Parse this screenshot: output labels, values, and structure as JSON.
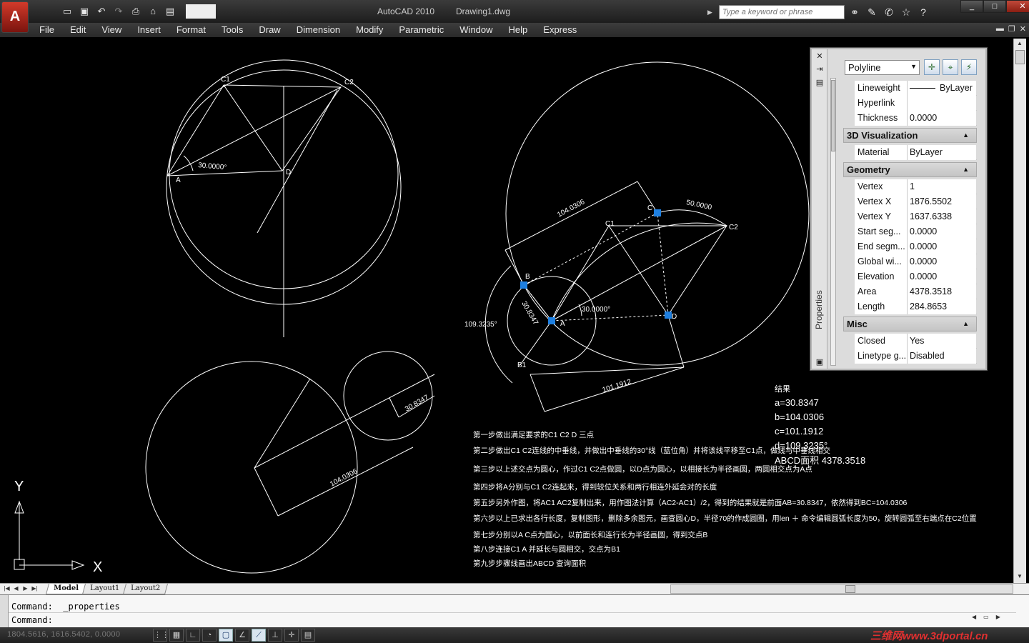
{
  "titlebar": {
    "app_name": "AutoCAD 2010",
    "document": "Drawing1.dwg",
    "search_placeholder": "Type a keyword or phrase",
    "window_controls": [
      "_",
      "□",
      "✕"
    ]
  },
  "menubar": {
    "items": [
      "File",
      "Edit",
      "View",
      "Insert",
      "Format",
      "Tools",
      "Draw",
      "Dimension",
      "Modify",
      "Parametric",
      "Window",
      "Help",
      "Express"
    ]
  },
  "drawing": {
    "circle1_points": [
      "C1",
      "C2",
      "A",
      "D"
    ],
    "dim_angle1": "30.0000°",
    "labels2": [
      "B",
      "C",
      "C1",
      "C2",
      "A",
      "D",
      "B1"
    ],
    "dim_top": "104.0306",
    "dim_r50": "50.0000",
    "dim_a": "30.8347",
    "dim_angle2": "30.0000°",
    "dim_angle3": "109.3235°",
    "dim_bottom": "101.1912",
    "dim_small": "30.8347",
    "dim_big": "104.0306",
    "ucs_y": "Y",
    "ucs_x": "X"
  },
  "results": {
    "heading": "结果",
    "a": "a=30.8347",
    "b": "b=104.0306",
    "c": "c=101.1912",
    "d": "d=109.3235°",
    "area": "ABCD面积 4378.3518"
  },
  "steps": [
    "第一步做出满足要求的C1  C2 D 三点",
    "第二步做出C1  C2连线的中垂线，并做出中垂线的30°线（蓝位角）并将该线平移至C1点，做线与中垂线相交",
    "第三步以上述交点为圆心，作过C1 C2点做圆，以D点为圆心，以相接长为半径画圆，两圆相交点为A点",
    "第四步将A分别与C1 C2连起来，得到较位关系和两行相连外延会对的长度",
    "第五步另外作图，将AC1 AC2复制出来，用作图法计算（AC2-AC1）/2，得到的结果就是前面AB=30.8347，依然得到BC=104.0306",
    "第六步以上已求出各行长度，复制图形，删除多余图元，画查圆心D，半径70的作成圆圈，用len ＋ 命令编辑圆弧长度为50，旋转圆弧至右端点在C2位置",
    "第七步分别以A C点为圆心，以前面长和连行长为半径画圆，得到交点B",
    "第八步连接C1 A 并延长与圆相交，交点为B1",
    "第九步步骤线画出ABCD 查询面积"
  ],
  "properties": {
    "palette_title": "Properties",
    "object_type": "Polyline",
    "rows_top": [
      {
        "k": "Lineweight",
        "v": "ByLayer"
      },
      {
        "k": "Hyperlink",
        "v": ""
      },
      {
        "k": "Thickness",
        "v": "0.0000"
      }
    ],
    "sec_3d": "3D Visualization",
    "rows_3d": [
      {
        "k": "Material",
        "v": "ByLayer"
      }
    ],
    "sec_geometry": "Geometry",
    "rows_geometry": [
      {
        "k": "Vertex",
        "v": "1"
      },
      {
        "k": "Vertex X",
        "v": "1876.5502"
      },
      {
        "k": "Vertex Y",
        "v": "1637.6338"
      },
      {
        "k": "Start seg...",
        "v": "0.0000"
      },
      {
        "k": "End segm...",
        "v": "0.0000"
      },
      {
        "k": "Global wi...",
        "v": "0.0000"
      },
      {
        "k": "Elevation",
        "v": "0.0000"
      },
      {
        "k": "Area",
        "v": "4378.3518"
      },
      {
        "k": "Length",
        "v": "284.8653"
      }
    ],
    "sec_misc": "Misc",
    "rows_misc": [
      {
        "k": "Closed",
        "v": "Yes"
      },
      {
        "k": "Linetype g...",
        "v": "Disabled"
      }
    ]
  },
  "tabs": [
    "Model",
    "Layout1",
    "Layout2"
  ],
  "command": {
    "line1": "Command:  _properties",
    "line2": "Command:"
  },
  "status": {
    "coords": "1804.5616, 1616.5402, 0.0000",
    "watermark": "三维网www.3dportal.cn"
  },
  "colors": {
    "grip": "#1e7fe0",
    "accent": "#d13a2a"
  }
}
